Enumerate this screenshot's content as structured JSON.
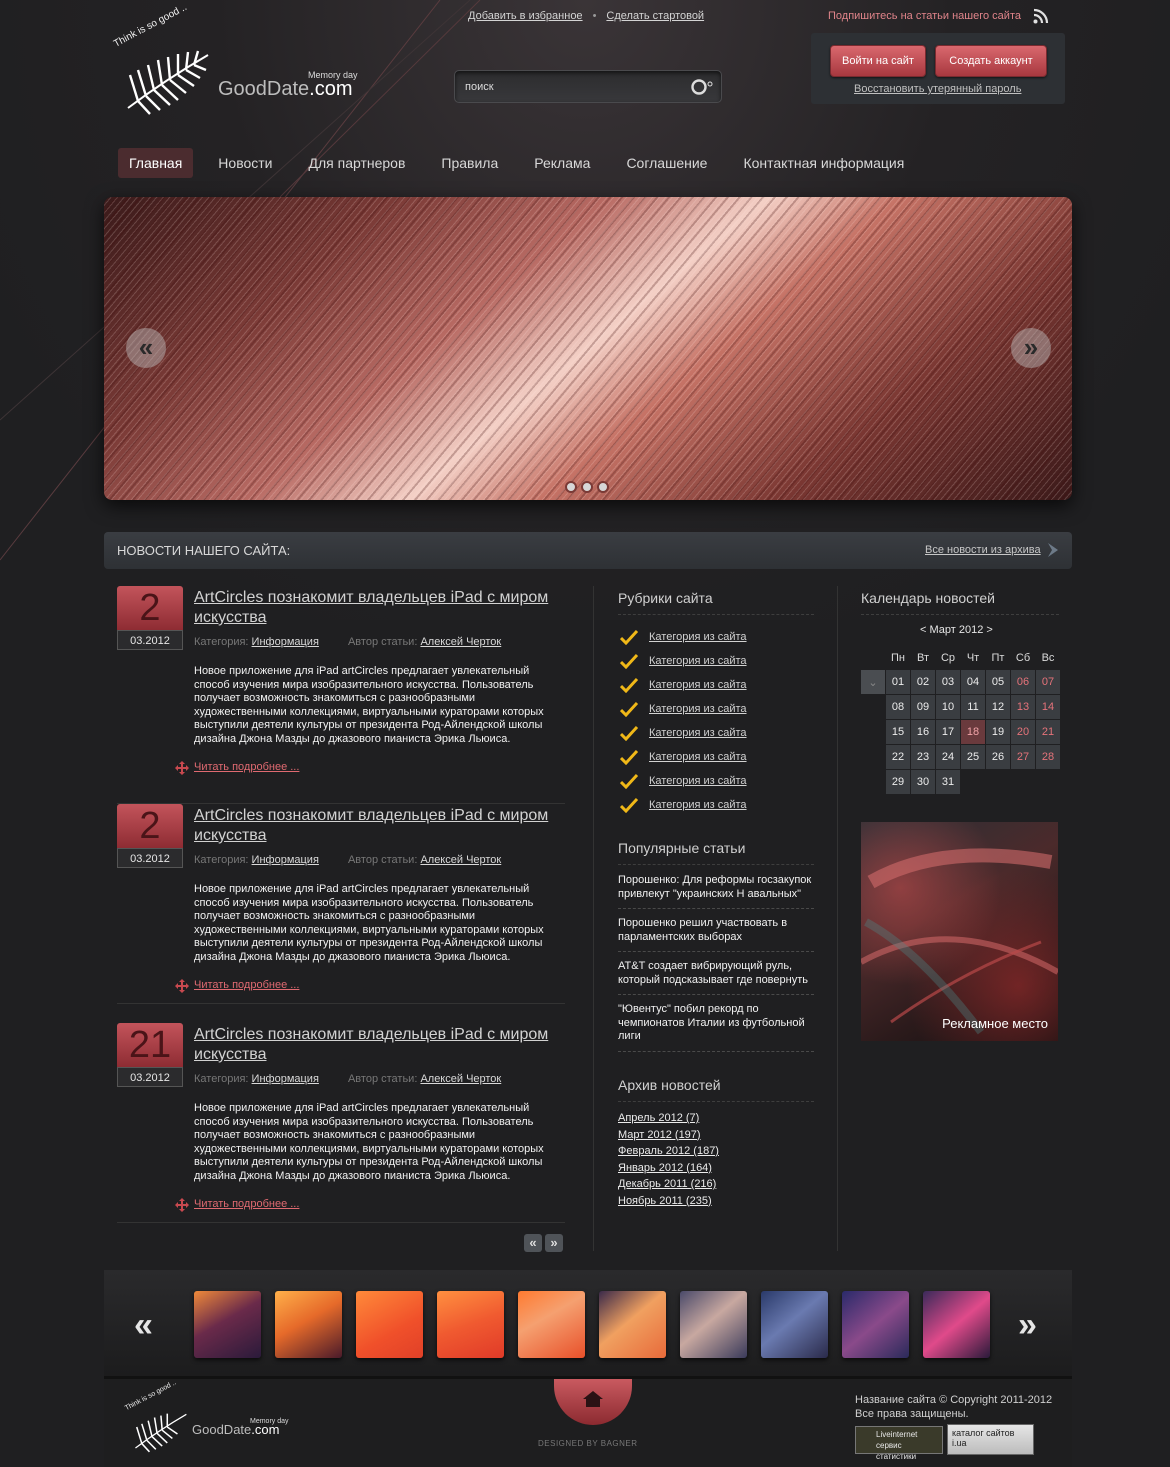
{
  "header": {
    "logo": {
      "brand_prefix": "GoodDate",
      "brand_suffix": ".com",
      "subtitle": "Memory day",
      "motto": "Think is so good .."
    },
    "top_links": [
      "Добавить в избранное",
      "Сделать стартовой"
    ],
    "search": {
      "placeholder": "поиск"
    },
    "subscribe": "Подпишитесь на статьи нашего сайта",
    "login": {
      "login_btn": "Войти на сайт",
      "register_btn": "Создать аккаунт",
      "restore_link": "Восстановить утерянный пароль"
    }
  },
  "nav": [
    "Главная",
    "Новости",
    "Для партнеров",
    "Правила",
    "Реклама",
    "Соглашение",
    "Контактная информация"
  ],
  "slider": {
    "prev": "«",
    "next": "»"
  },
  "news": {
    "heading": "НОВОСТИ НАШЕГО САЙТА:",
    "archive_link": "Все новости из архива",
    "articles": [
      {
        "day": "2",
        "date": "03.2012",
        "title": "ArtCircles познакомит владельцев iPad с миром искусства",
        "category_label": "Категория:",
        "category": "Информация",
        "author_label": "Автор статьи:",
        "author": "Алексей Черток",
        "body": "Новое приложение для iPad artCircles предлагает увлекательный способ изучения мира изобразительного искусства. Пользователь получает возможность знакомиться с разнообразными художественными коллекциями, виртуальными кураторами которых выступили деятели культуры от президента Род-Айлендской школы дизайна Джона Мазды до джазового пианиста Эрика Льюиса.",
        "more": "Читать подробнее ..."
      },
      {
        "day": "2",
        "date": "03.2012",
        "title": "ArtCircles познакомит владельцев iPad с миром искусства",
        "category_label": "Категория:",
        "category": "Информация",
        "author_label": "Автор статьи:",
        "author": "Алексей Черток",
        "body": "Новое приложение для iPad artCircles предлагает увлекательный способ изучения мира изобразительного искусства. Пользователь получает возможность знакомиться с разнообразными художественными коллекциями, виртуальными кураторами которых выступили деятели культуры от президента Род-Айлендской школы дизайна Джона Мазды до джазового пианиста Эрика Льюиса.",
        "more": "Читать подробнее ..."
      },
      {
        "day": "21",
        "date": "03.2012",
        "title": "ArtCircles познакомит владельцев iPad с миром искусства",
        "category_label": "Категория:",
        "category": "Информация",
        "author_label": "Автор статьи:",
        "author": "Алексей Черток",
        "body": "Новое приложение для iPad artCircles предлагает увлекательный способ изучения мира изобразительного искусства. Пользователь получает возможность знакомиться с разнообразными художественными коллекциями, виртуальными кураторами которых выступили деятели культуры от президента Род-Айлендской школы дизайна Джона Мазды до джазового пианиста Эрика Льюиса.",
        "more": "Читать подробнее ..."
      }
    ],
    "pager": {
      "prev": "«",
      "next": "»"
    }
  },
  "rubrics": {
    "heading": "Рубрики сайта",
    "items": [
      "Категория из сайта",
      "Категория из сайта",
      "Категория из сайта",
      "Категория из сайта",
      "Категория из сайта",
      "Категория из сайта",
      "Категория из сайта",
      "Категория из сайта"
    ]
  },
  "popular": {
    "heading": "Популярные статьи",
    "items": [
      "Порошенко: Для реформы госзакупок привлекут \"украинских Н авальных\"",
      "Порошенко решил участвовать в парламентских выборах",
      "AT&T создает вибрирующий руль, который подсказывает где повернуть",
      "\"Ювентус\" побил рекорд по чемпионатов Италии из футбольной лиги"
    ]
  },
  "archive": {
    "heading": "Архив новостей",
    "items": [
      "Апрель 2012 (7)",
      "Март 2012 (197)",
      "Февраль 2012 (187)",
      "Январь 2012 (164)",
      "Декабрь 2011 (216)",
      "Ноябрь 2011 (235)"
    ]
  },
  "calendar": {
    "heading": "Календарь новостей",
    "month": "< Март 2012 >",
    "weekdays": [
      "Пн",
      "Вт",
      "Ср",
      "Чт",
      "Пт",
      "Сб",
      "Вс"
    ],
    "weeks": [
      [
        "01",
        "02",
        "03",
        "04",
        "05",
        "06",
        "07"
      ],
      [
        "08",
        "09",
        "10",
        "11",
        "12",
        "13",
        "14"
      ],
      [
        "15",
        "16",
        "17",
        "18",
        "19",
        "20",
        "21"
      ],
      [
        "22",
        "23",
        "24",
        "25",
        "26",
        "27",
        "28"
      ],
      [
        "29",
        "30",
        "31",
        "",
        "",
        "",
        ""
      ]
    ],
    "today": "18"
  },
  "ad": {
    "label": "Рекламное место"
  },
  "gallery": {
    "prev": "«",
    "next": "»",
    "thumb_count": 10
  },
  "footer": {
    "logo": {
      "brand_prefix": "GoodDate",
      "brand_suffix": ".com",
      "subtitle": "Memory day",
      "motto": "Think is so good .."
    },
    "designed": "DESIGNED BY BAGNER",
    "copyright_line1": "Название сайта © Copyright 2011-2012",
    "copyright_line2": "Все права защищены.",
    "counter1": "Liveinternet сервис статистики",
    "counter2": "каталог сайтов i.ua"
  },
  "colors": {
    "accent": "#c3545b",
    "link_red": "#e06a71",
    "background": "#1f1f21"
  }
}
